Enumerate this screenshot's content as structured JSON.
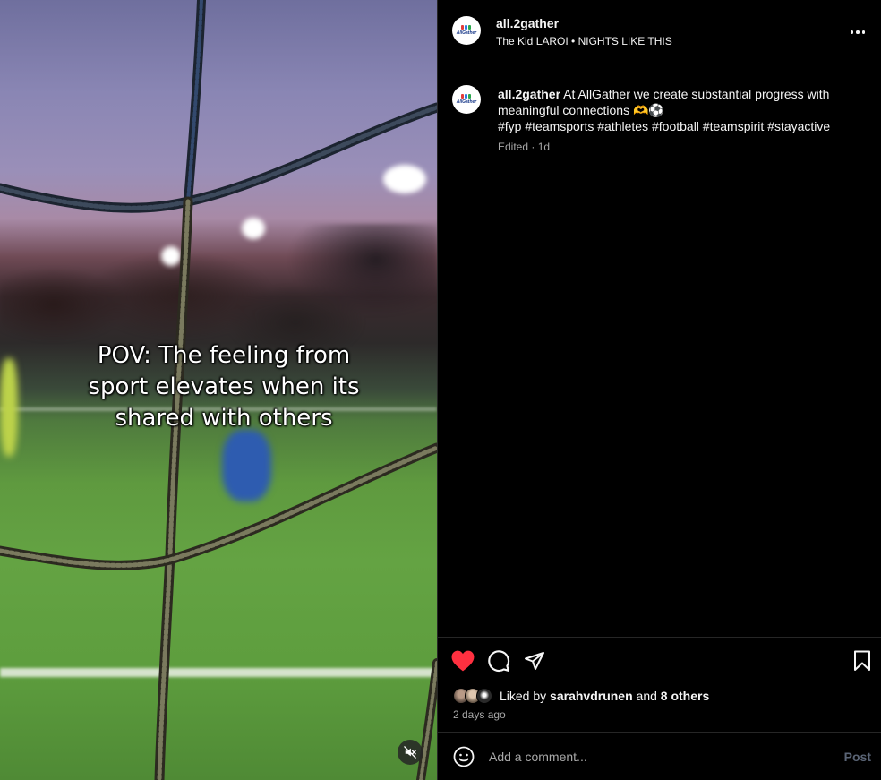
{
  "post": {
    "username": "all.2gather",
    "music": "The Kid LAROI • NIGHTS LIKE THIS",
    "avatar_logo_text": "AllGather",
    "caption_overlay": [
      "POV: The feeling from",
      "sport elevates when its",
      "shared with others"
    ],
    "more_icon": "more-horizontal-icon"
  },
  "comment": {
    "username": "all.2gather",
    "text_line1": "At AllGather we create substantial progress with",
    "text_line2": "meaningful connections 🫶⚽",
    "hashtags": "#fyp #teamsports #athletes #football #teamspirit #stayactive",
    "meta": "Edited · 1d"
  },
  "actions": {
    "like_icon": "heart-filled-icon",
    "comment_icon": "comment-icon",
    "share_icon": "paper-plane-icon",
    "save_icon": "bookmark-icon",
    "liked_by_prefix": "Liked by",
    "liked_by_user": "sarahvdrunen",
    "liked_by_and": "and",
    "liked_by_others": "8 others",
    "time_ago": "2 days ago"
  },
  "comment_bar": {
    "placeholder": "Add a comment...",
    "post_label": "Post",
    "emoji_icon": "smiley-icon"
  },
  "media": {
    "mute_icon": "speaker-muted-icon"
  },
  "colors": {
    "like_red": "#ff3040",
    "panel_bg": "#000000",
    "secondary_text": "#a8a8a8",
    "post_disabled": "#5a6475"
  }
}
